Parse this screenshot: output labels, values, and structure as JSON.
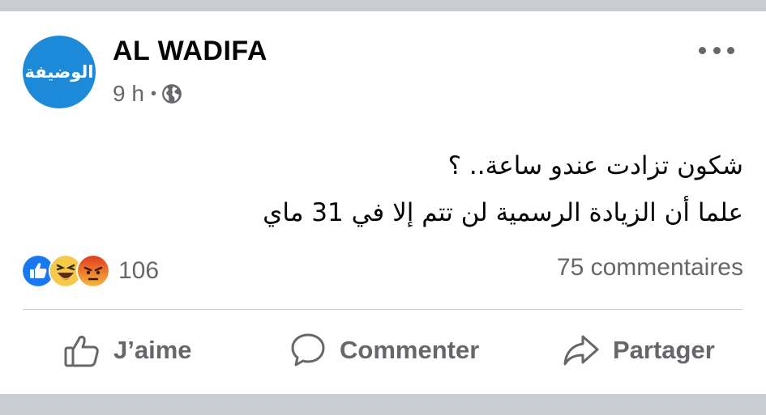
{
  "post": {
    "author": "AL WADIFA",
    "avatar_text": "الوضيفة",
    "time": "9 h",
    "visibility_icon": "globe-icon",
    "more_icon": "more-options-icon",
    "text_lines": [
      "شكون تزادت عندو ساعة.. ؟",
      "علما أن الزيادة الرسمية لن تتم إلا في 31 ماي"
    ]
  },
  "reactions": {
    "icons": [
      "like-reaction-icon",
      "haha-reaction-icon",
      "angry-reaction-icon"
    ],
    "count": "106"
  },
  "comments": {
    "count_label": "75 commentaires"
  },
  "actions": {
    "like_label": "J’aime",
    "comment_label": "Commenter",
    "share_label": "Partager"
  },
  "colors": {
    "avatar_blue": "#1c8ad8",
    "like_blue": "#1877f2",
    "haha_yellow": "#f7c94b",
    "angry_orange": "#e9710f",
    "muted_text": "#65676b",
    "page_background": "#c9ccd1"
  }
}
